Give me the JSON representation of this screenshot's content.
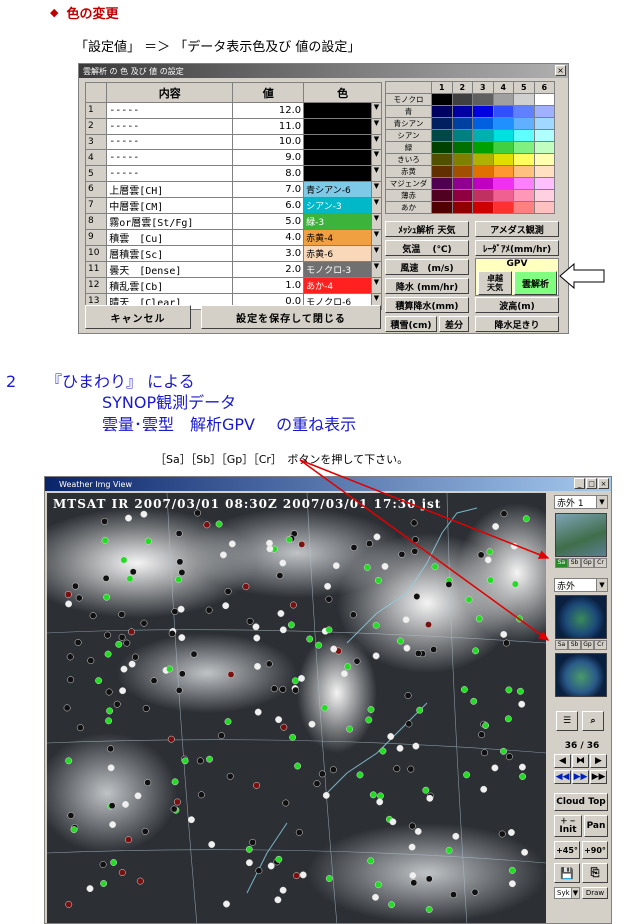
{
  "section1": {
    "title": "色の変更",
    "subtitle": "「設定値」 ＝＞ 「データ表示色及び 値の設定」"
  },
  "dialog": {
    "title": "雲解析 の 色 及び 値 の設定",
    "headers": {
      "content": "内容",
      "value": "値",
      "color": "色"
    },
    "rows": [
      {
        "no": "1",
        "content": "-----",
        "value": "12.0",
        "color_label": "",
        "color": "#000000"
      },
      {
        "no": "2",
        "content": "-----",
        "value": "11.0",
        "color_label": "",
        "color": "#000000"
      },
      {
        "no": "3",
        "content": "-----",
        "value": "10.0",
        "color_label": "",
        "color": "#000000"
      },
      {
        "no": "4",
        "content": "-----",
        "value": "9.0",
        "color_label": "",
        "color": "#000000"
      },
      {
        "no": "5",
        "content": "-----",
        "value": "8.0",
        "color_label": "",
        "color": "#000000"
      },
      {
        "no": "6",
        "content": "上層雲[CH]",
        "value": "7.0",
        "color_label": "青シアン-6",
        "color": "#7ec8e8"
      },
      {
        "no": "7",
        "content": "中層雲[CM]",
        "value": "6.0",
        "color_label": "シアン-3",
        "color": "#00b8c8"
      },
      {
        "no": "8",
        "content": "霧or層雲[St/Fg]",
        "value": "5.0",
        "color_label": "緑-3",
        "color": "#3cb43c"
      },
      {
        "no": "9",
        "content": "積雲　[Cu]",
        "value": "4.0",
        "color_label": "赤黄-4",
        "color": "#f0a040"
      },
      {
        "no": "10",
        "content": "層積雲[Sc]",
        "value": "3.0",
        "color_label": "赤黄-6",
        "color": "#f8d8b8"
      },
      {
        "no": "11",
        "content": "曇天　[Dense]",
        "value": "2.0",
        "color_label": "モノクロ-3",
        "color": "#707070"
      },
      {
        "no": "12",
        "content": "積乱雲[Cb]",
        "value": "1.0",
        "color_label": "あか-4",
        "color": "#ff2020"
      },
      {
        "no": "13",
        "content": "晴天　[Clear]",
        "value": "0.0",
        "color_label": "モノクロ-6",
        "color": "#ffffff"
      }
    ],
    "cancel": "キャンセル",
    "save": "設定を保存して閉じる",
    "palette": {
      "cols": [
        "1",
        "2",
        "3",
        "4",
        "5",
        "6"
      ],
      "rows": [
        {
          "label": "モノクロ",
          "colors": [
            "#000000",
            "#404040",
            "#606060",
            "#a0a0a0",
            "#d0d0d0",
            "#ffffff"
          ]
        },
        {
          "label": "青",
          "colors": [
            "#000060",
            "#0000a0",
            "#0000e0",
            "#3050ff",
            "#6080ff",
            "#a0b0ff"
          ]
        },
        {
          "label": "青シアン",
          "colors": [
            "#002060",
            "#0040a0",
            "#0060e0",
            "#2090ff",
            "#60b0ff",
            "#a0d8ff"
          ]
        },
        {
          "label": "シアン",
          "colors": [
            "#004848",
            "#008080",
            "#00b0b0",
            "#00e0e0",
            "#60ffff",
            "#b0ffff"
          ]
        },
        {
          "label": "緑",
          "colors": [
            "#004000",
            "#007000",
            "#00a000",
            "#40d040",
            "#80f080",
            "#c0ffc0"
          ]
        },
        {
          "label": "きいろ",
          "colors": [
            "#505000",
            "#808000",
            "#b0b000",
            "#e0e000",
            "#ffff60",
            "#ffffb0"
          ]
        },
        {
          "label": "赤黄",
          "colors": [
            "#603000",
            "#a05000",
            "#e07000",
            "#ff9830",
            "#ffc080",
            "#ffe0c0"
          ]
        },
        {
          "label": "マジェンダ",
          "colors": [
            "#500050",
            "#900090",
            "#c000c0",
            "#f030f0",
            "#ff80ff",
            "#ffc0ff"
          ]
        },
        {
          "label": "薄赤",
          "colors": [
            "#500020",
            "#900040",
            "#c03060",
            "#f06090",
            "#ff98b8",
            "#ffd0e0"
          ]
        },
        {
          "label": "あか",
          "colors": [
            "#500000",
            "#900000",
            "#d00000",
            "#ff3030",
            "#ff8080",
            "#ffc0c0"
          ]
        }
      ]
    },
    "menu": {
      "mesh": "ﾒｯｼｭ解析 天気",
      "amedas": "アメダス観測",
      "temp": "気温　 (℃)",
      "radar": "ﾚｰﾀﾞｱﾒ(mm/hr)",
      "wind": "風速　(m/s)",
      "gpv_label": "GPV",
      "rain": "降水 (mm/hr)",
      "takuetsu": "卓越\n天気",
      "cloud": "雲解析",
      "accum_rain": "積算降水(mm)",
      "wave": "波高(m)",
      "snow": "積雪(cm)",
      "diff": "差分",
      "rain_foot": "降水足きり"
    }
  },
  "section2": {
    "num": "2",
    "line1": "『ひまわり』 による",
    "line2": "SYNOP観測データ",
    "line3": "雲量･雲型　解析GPV　 の重ね表示",
    "note": "［Sa］［Sb］［Gp］［Cr］　ボタンを押して下さい。"
  },
  "viewer": {
    "title": "Weather Img View",
    "stamp": "MTSAT  IR  2007/03/01 08:30Z   2007/03/01 17:30 jst",
    "select1": "赤外 1",
    "select2": "赤外",
    "small_btns": [
      "Sa",
      "Sb",
      "Gp",
      "Cr"
    ],
    "frame": "36 / 36",
    "cloud_top": "Cloud Top",
    "init": "Init",
    "pan": "Pan",
    "plus45": "+45°",
    "plus90": "+90°",
    "syk": "Syk",
    "draw": "Draw",
    "accent": "#2a8a2a"
  }
}
